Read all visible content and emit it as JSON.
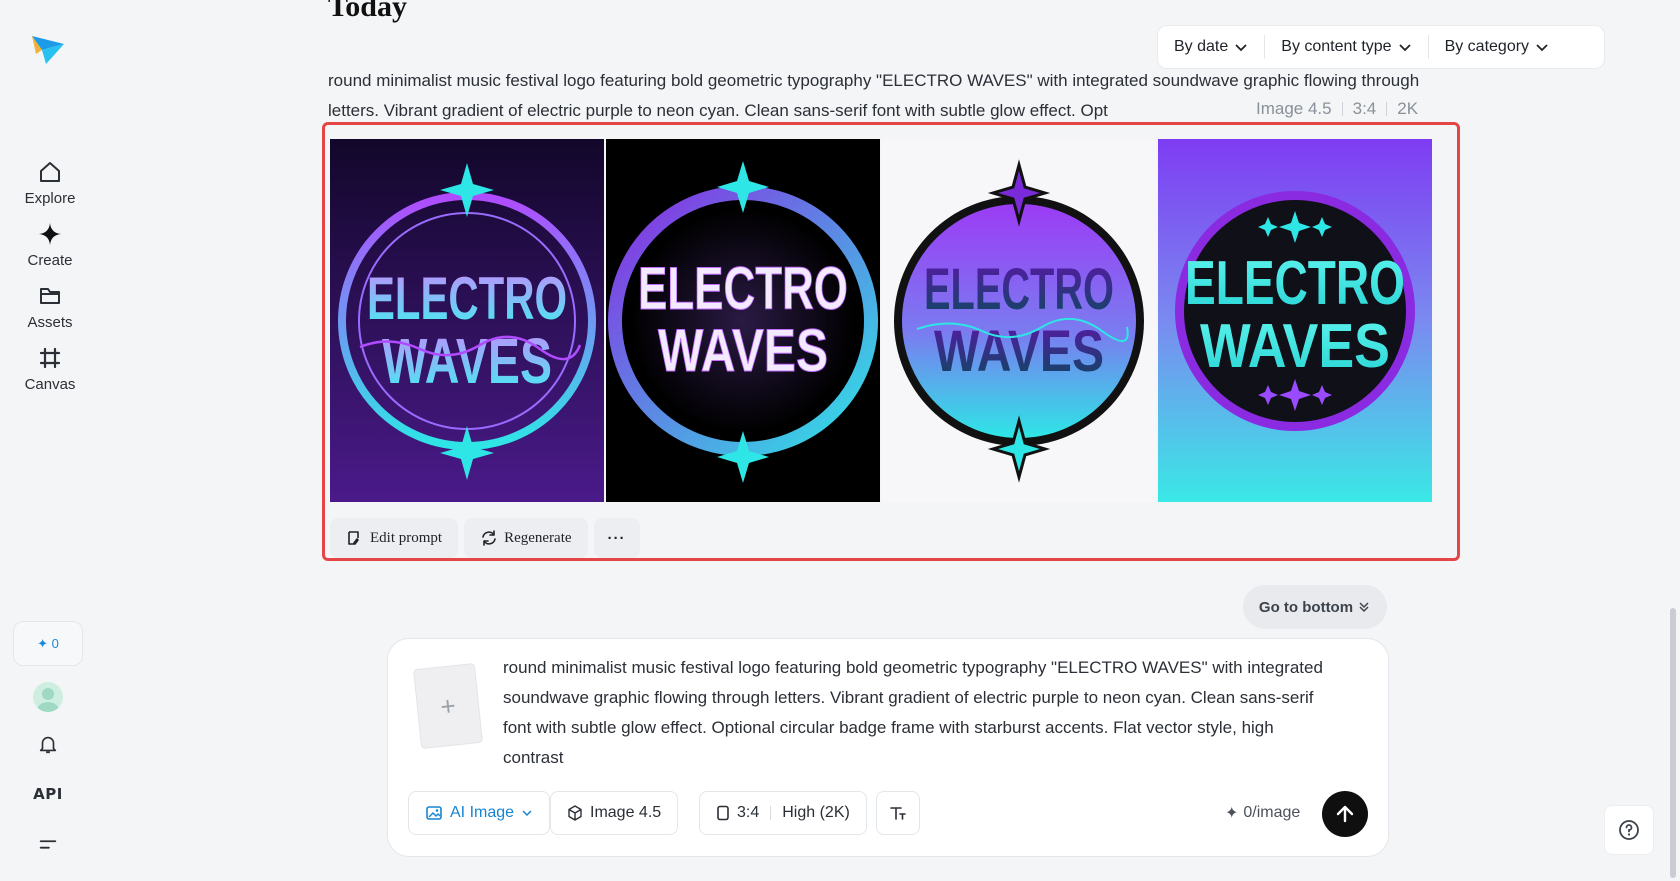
{
  "section": {
    "title": "Today"
  },
  "filters": [
    {
      "label": "By date"
    },
    {
      "label": "By content type"
    },
    {
      "label": "By category"
    }
  ],
  "prompt": {
    "text": "round minimalist music festival logo featuring bold geometric typography \"ELECTRO WAVES\" with integrated soundwave graphic flowing through letters. Vibrant gradient of electric purple to neon cyan. Clean sans-serif font with subtle glow effect. Opt",
    "model": "Image 4.5",
    "ratio": "3:4",
    "resolution": "2K"
  },
  "images": [
    {
      "line1": "ELECTRO",
      "line2": "WAVES",
      "bg": "#1c0b3a"
    },
    {
      "line1": "ELECTRO",
      "line2": "WAVES",
      "bg": "#000000"
    },
    {
      "line1": "ELECTRO",
      "line2": "WAVES",
      "bg": "#f7f7fa"
    },
    {
      "line1": "ELECTRO",
      "line2": "WAVES",
      "bg": "#7a49f0"
    }
  ],
  "actions": {
    "edit_prompt": "Edit prompt",
    "regenerate": "Regenerate",
    "more": "···"
  },
  "go_bottom": {
    "label": "Go to bottom"
  },
  "sidebar": {
    "items": [
      {
        "label": "Explore",
        "icon": "home-icon"
      },
      {
        "label": "Create",
        "icon": "sparkle-icon"
      },
      {
        "label": "Assets",
        "icon": "folder-icon"
      },
      {
        "label": "Canvas",
        "icon": "frame-icon"
      }
    ],
    "credits": "0",
    "api_label": "API"
  },
  "composer": {
    "upload_symbol": "+",
    "text": "round minimalist music festival logo featuring bold geometric typography \"ELECTRO WAVES\" with integrated soundwave graphic flowing through letters. Vibrant gradient of electric purple to neon cyan. Clean sans-serif font with subtle glow effect. Optional circular badge frame with starburst accents. Flat vector style, high contrast",
    "mode": "AI Image",
    "model": "Image 4.5",
    "ratio": "3:4",
    "quality": "High (2K)",
    "cost": "0/image"
  },
  "colors": {
    "accent": "#1685d3",
    "highlight_border": "#e64545",
    "purple": "#8a2be2",
    "cyan": "#2ee6e6"
  }
}
